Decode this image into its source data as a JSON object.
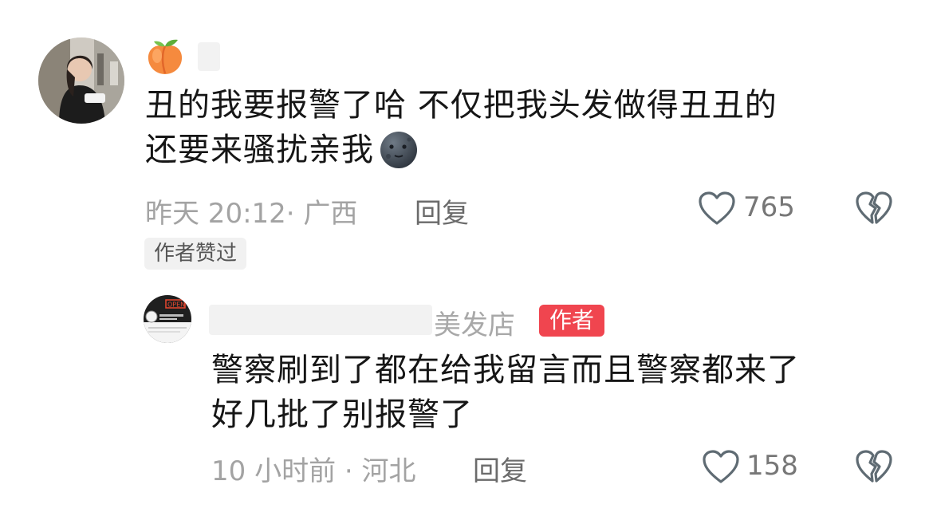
{
  "comments": [
    {
      "avatar_icon": "user-avatar-photo",
      "name_icon": "peach-emoji-icon",
      "text_line1": "丑的我要报警了哈  不仅把我头发做得丑丑的",
      "text_line2": "还要来骚扰亲我",
      "text_emoji": "dark-moon-face-emoji-icon",
      "time_location": "昨天 20:12· 广西",
      "reply_label": "回复",
      "like_count": "765",
      "liked_badge": "作者赞过"
    },
    {
      "avatar_icon": "salon-avatar-photo",
      "name_suffix": "美发店",
      "author_badge": "作者",
      "text_line1": "警察刷到了都在给我留言而且警察都来了",
      "text_line2": "好几批了别报警了",
      "time_location": "10 小时前 · 河北",
      "reply_label": "回复",
      "like_count": "158"
    }
  ],
  "colors": {
    "author_badge": "#f0454f",
    "meta_text": "#a3a3a3",
    "icon_stroke": "#5f6b73"
  }
}
